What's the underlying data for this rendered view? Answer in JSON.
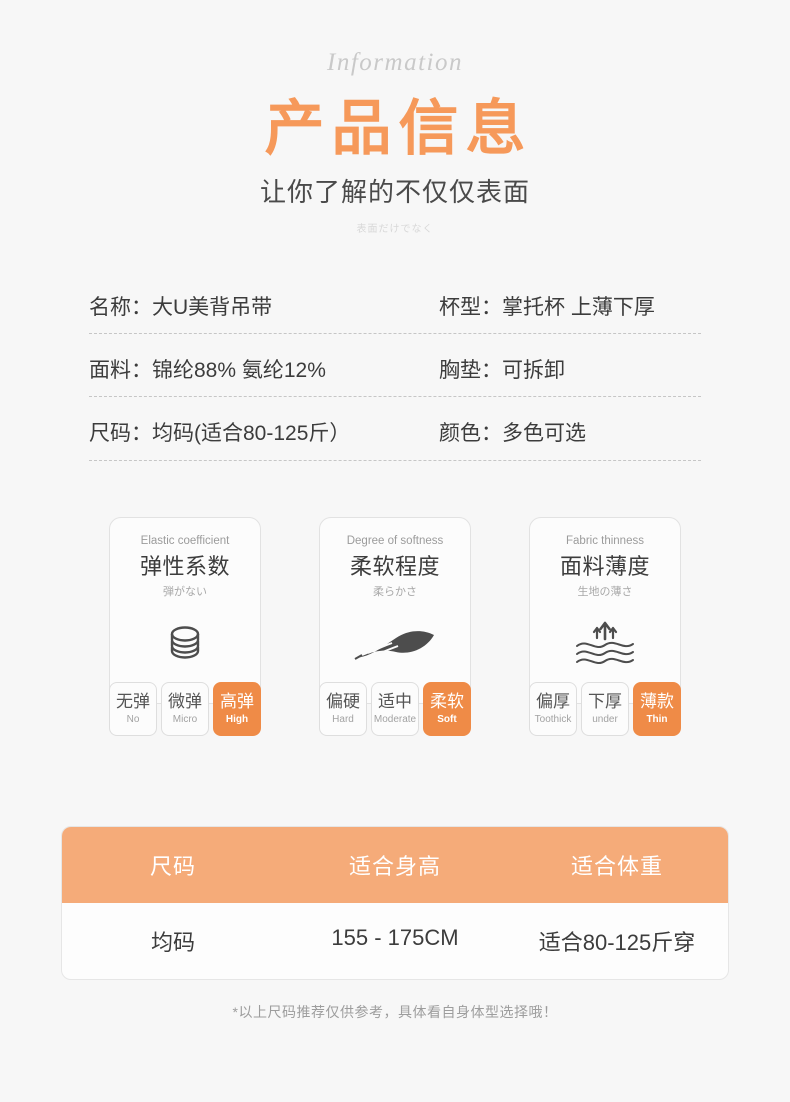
{
  "header": {
    "script_word": "Information",
    "title": "产品信息",
    "subtitle": "让你了解的不仅仅表面",
    "jp_note": "表面だけでなく",
    "title_color": "#f6995a"
  },
  "specs": [
    {
      "left_label": "名称：",
      "left_value": "大U美背吊带",
      "right_label": "杯型：",
      "right_value": "掌托杯  上薄下厚"
    },
    {
      "left_label": "面料：",
      "left_value": "锦纶88%  氨纶12%",
      "right_label": "胸垫：",
      "right_value": "可拆卸"
    },
    {
      "left_label": "尺码：",
      "left_value": "均码(适合80-125斤）",
      "right_label": "颜色：",
      "right_value": "多色可选"
    }
  ],
  "cards": [
    {
      "en": "Elastic coefficient",
      "cn": "弹性系数",
      "jp": "弾がない",
      "icon": "stacked-discs-icon",
      "chips": [
        {
          "cn": "无弹",
          "en": "No",
          "active": false
        },
        {
          "cn": "微弹",
          "en": "Micro",
          "active": false
        },
        {
          "cn": "高弹",
          "en": "High",
          "active": true
        }
      ]
    },
    {
      "en": "Degree of softness",
      "cn": "柔软程度",
      "jp": "柔らかさ",
      "icon": "feather-icon",
      "chips": [
        {
          "cn": "偏硬",
          "en": "Hard",
          "active": false
        },
        {
          "cn": "适中",
          "en": "Moderate",
          "active": false
        },
        {
          "cn": "柔软",
          "en": "Soft",
          "active": true
        }
      ]
    },
    {
      "en": "Fabric thinness",
      "cn": "面料薄度",
      "jp": "生地の薄さ",
      "icon": "breathable-waves-icon",
      "chips": [
        {
          "cn": "偏厚",
          "en": "Toothick",
          "active": false
        },
        {
          "cn": "下厚",
          "en": "under",
          "active": false
        },
        {
          "cn": "薄款",
          "en": "Thin",
          "active": true
        }
      ]
    }
  ],
  "size_table": {
    "headers": [
      "尺码",
      "适合身高",
      "适合体重"
    ],
    "rows": [
      [
        "均码",
        "155 - 175CM",
        "适合80-125斤穿"
      ]
    ],
    "note": "*以上尺码推荐仅供参考，具体看自身体型选择哦！",
    "header_color": "#f5ab79",
    "accent_color": "#ef8b47"
  }
}
